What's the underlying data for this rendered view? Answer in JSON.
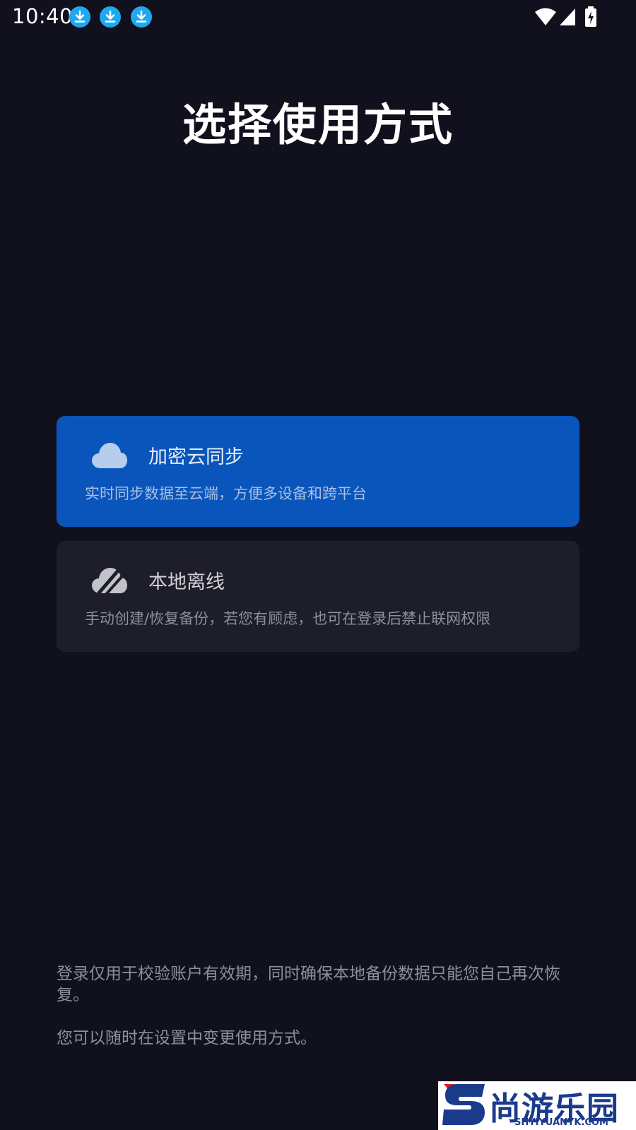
{
  "status_bar": {
    "time": "10:40",
    "icons": [
      "download-icon",
      "download-icon",
      "download-icon",
      "wifi-icon",
      "signal-icon",
      "battery-charging-icon"
    ]
  },
  "title": "选择使用方式",
  "options": [
    {
      "icon": "cloud-icon",
      "title": "加密云同步",
      "description": "实时同步数据至云端，方便多设备和跨平台",
      "selected": true
    },
    {
      "icon": "cloud-off-icon",
      "title": "本地离线",
      "description": "手动创建/恢复备份，若您有顾虑，也可在登录后禁止联网权限",
      "selected": false
    }
  ],
  "footer": {
    "note1": "登录仅用于校验账户有效期，同时确保本地备份数据只能您自己再次恢复。",
    "note2": "您可以随时在设置中变更使用方式。"
  },
  "watermark": {
    "cn": "尚游乐园",
    "en": "SHYIYUANYK.COM"
  },
  "colors": {
    "background": "#11111e",
    "selected_card": "#0a55bb",
    "card": "#1e1e2b",
    "download_badge": "#1fa8f0"
  }
}
